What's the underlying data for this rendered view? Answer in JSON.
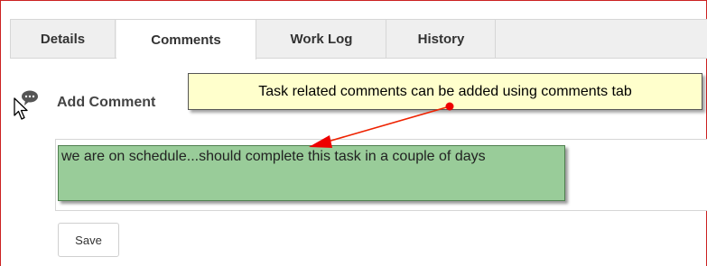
{
  "tabs": [
    {
      "label": "Details",
      "active": false
    },
    {
      "label": "Comments",
      "active": true
    },
    {
      "label": "Work Log",
      "active": false
    },
    {
      "label": "History",
      "active": false
    }
  ],
  "section": {
    "title": "Add Comment",
    "icon": "comment-bubble-icon"
  },
  "callout": {
    "text": "Task related comments can be added using comments tab"
  },
  "comment": {
    "value": "we are on schedule...should complete this task in a couple of days"
  },
  "actions": {
    "save_label": "Save"
  },
  "colors": {
    "frame_border": "#cc2222",
    "callout_bg": "#ffffcc",
    "highlight_bg": "#99cc99",
    "arrow": "#ee2200"
  }
}
